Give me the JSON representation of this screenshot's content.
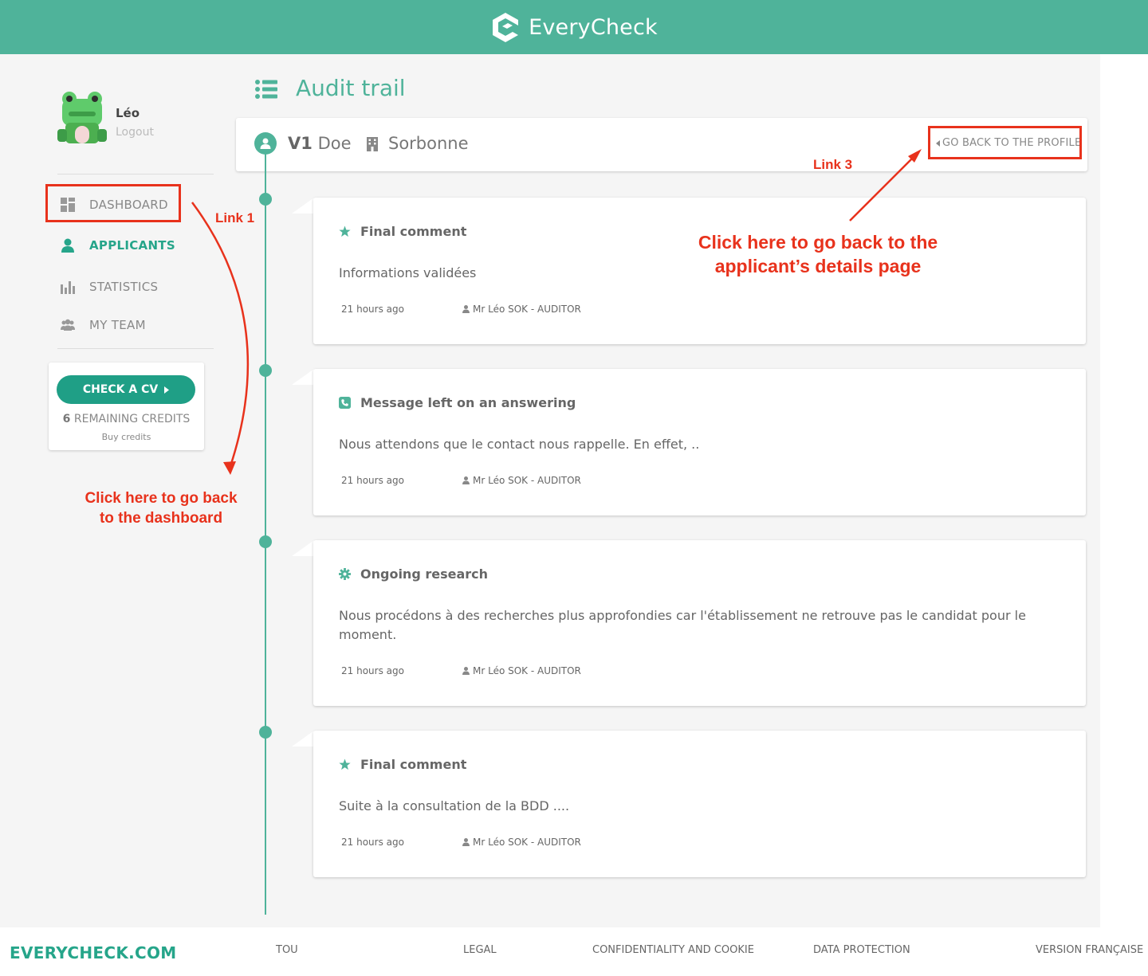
{
  "header": {
    "brand": "EveryCheck"
  },
  "user": {
    "name": "Léo",
    "logout": "Logout"
  },
  "nav": [
    {
      "label": "DASHBOARD",
      "icon": "dashboard-icon"
    },
    {
      "label": "APPLICANTS",
      "icon": "person-icon",
      "active": true
    },
    {
      "label": "STATISTICS",
      "icon": "bar-chart-icon"
    },
    {
      "label": "MY TEAM",
      "icon": "team-icon"
    }
  ],
  "credits": {
    "button": "CHECK A CV",
    "count": "6",
    "label": "REMAINING CREDITS",
    "buy": "Buy credits"
  },
  "page": {
    "title": "Audit trail"
  },
  "applicant": {
    "prefix": "V1",
    "name": "Doe",
    "school": "Sorbonne",
    "back_link": "GO BACK TO THE PROFILE"
  },
  "events": [
    {
      "icon": "star-icon",
      "title": "Final comment",
      "body": "Informations validées",
      "time": "21 hours ago",
      "author": "Mr Léo SOK - AUDITOR"
    },
    {
      "icon": "phone-icon",
      "title": "Message left on an answering",
      "body": "Nous attendons que le contact nous rappelle. En effet, ..",
      "time": "21 hours ago",
      "author": "Mr Léo SOK - AUDITOR"
    },
    {
      "icon": "gear-icon",
      "title": "Ongoing research",
      "body": "Nous procédons à des recherches plus approfondies car l'établissement ne retrouve pas le candidat pour le moment.",
      "time": "21 hours ago",
      "author": "Mr Léo SOK - AUDITOR"
    },
    {
      "icon": "star-icon",
      "title": "Final comment",
      "body": "Suite à la consultation de la BDD ....",
      "time": "21 hours ago",
      "author": "Mr Léo SOK - AUDITOR"
    }
  ],
  "footer": {
    "brand": "EVERYCHECK.COM",
    "links": [
      "TOU",
      "LEGAL",
      "CONFIDENTIALITY AND COOKIE",
      "DATA PROTECTION",
      "VERSION FRANÇAISE"
    ]
  },
  "annotations": {
    "link1": "Link 1",
    "link1_text_line1": "Click here to go back",
    "link1_text_line2": "to the dashboard",
    "link3": "Link 3",
    "link3_text_line1": "Click here to go back to the",
    "link3_text_line2": "applicant’s details page"
  },
  "colors": {
    "brand": "#4fb39a",
    "accent": "#26a58a",
    "annotation": "#e8321c"
  }
}
